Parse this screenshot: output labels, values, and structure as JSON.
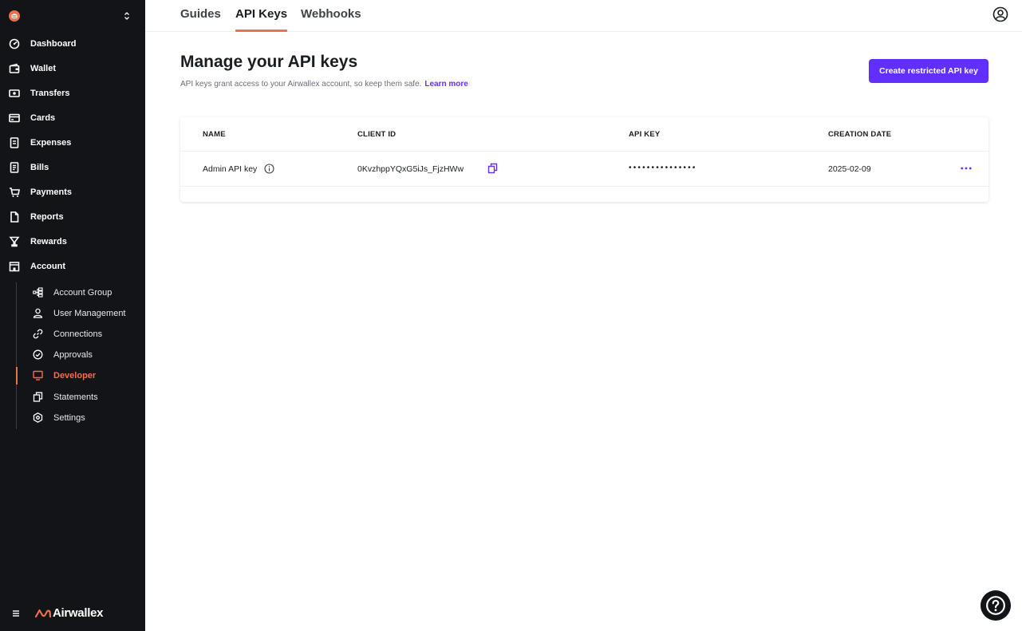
{
  "sidebar": {
    "nav": [
      {
        "label": "Dashboard",
        "icon": "dashboard-icon"
      },
      {
        "label": "Wallet",
        "icon": "wallet-icon"
      },
      {
        "label": "Transfers",
        "icon": "transfers-icon"
      },
      {
        "label": "Cards",
        "icon": "cards-icon"
      },
      {
        "label": "Expenses",
        "icon": "expenses-icon"
      },
      {
        "label": "Bills",
        "icon": "bills-icon"
      },
      {
        "label": "Payments",
        "icon": "payments-icon"
      },
      {
        "label": "Reports",
        "icon": "reports-icon"
      },
      {
        "label": "Rewards",
        "icon": "rewards-icon"
      },
      {
        "label": "Account",
        "icon": "account-icon"
      }
    ],
    "account_subnav": [
      {
        "label": "Account Group",
        "icon": "account-group-icon"
      },
      {
        "label": "User Management",
        "icon": "user-icon"
      },
      {
        "label": "Connections",
        "icon": "link-icon"
      },
      {
        "label": "Approvals",
        "icon": "check-circle-icon"
      },
      {
        "label": "Developer",
        "icon": "monitor-icon",
        "active": true
      },
      {
        "label": "Statements",
        "icon": "copy-icon"
      },
      {
        "label": "Settings",
        "icon": "settings-icon"
      }
    ],
    "brand": "Airwallex"
  },
  "tabs": [
    {
      "label": "Guides"
    },
    {
      "label": "API Keys",
      "active": true
    },
    {
      "label": "Webhooks"
    }
  ],
  "page": {
    "title": "Manage your API keys",
    "description": "API keys grant access to your Airwallex account, so keep them safe.",
    "learn_more": "Learn more",
    "create_button": "Create restricted API key"
  },
  "table": {
    "headers": {
      "name": "NAME",
      "client_id": "CLIENT ID",
      "api_key": "API KEY",
      "creation_date": "CREATION DATE"
    },
    "rows": [
      {
        "name": "Admin API key",
        "client_id": "0KvzhppYQxG5iJs_FjzHWw",
        "api_key": "•••••••••••••••",
        "creation_date": "2025-02-09"
      }
    ]
  },
  "colors": {
    "accent": "#612fff",
    "brand_orange": "#f26f4b",
    "sidebar_bg": "#121417"
  }
}
